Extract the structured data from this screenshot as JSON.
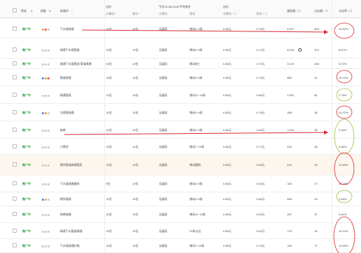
{
  "header": {
    "status": "状态",
    "status_arrow": "∨",
    "quality": "质量",
    "quality_arrow": "∨",
    "keyword": "关键词",
    "keyword_arrow": "↑",
    "bid_group": "出价",
    "bid_pc": "计算机 ↕",
    "bid_mobile": "移动 ↕",
    "rank_group": "今天22:08-23:00平均排名",
    "rank_pc": "计算机",
    "rank_mobile": "移动",
    "cpc_group": "出价",
    "cpc_pc": "计算机 ↕ ▽",
    "cpc_mobile": "移动 ↕ ▽",
    "impressions": "展现量 ↕ ▽",
    "clicks": "点击量 ↓ ▽",
    "ctr": "点击率 ↕ ▽"
  },
  "rows": [
    {
      "status": "推广中",
      "dots": [
        "orange",
        "red",
        "gray"
      ],
      "keyword": "下水道疏通",
      "bid_pc": "10位",
      "bid_mb": "10位",
      "rank_pc": "无展现",
      "rank_mb": "移动4~6条",
      "cpc_pc": "0.85元",
      "cpc_mb": "0.78元",
      "impr": "6,527",
      "clicks": "693",
      "ctr": "10.62%"
    },
    {
      "status": "推广中",
      "dots": [
        "gray",
        "gray",
        "gray"
      ],
      "keyword": "疏通下水道管道",
      "bid_pc": "10位",
      "bid_mb": "10位",
      "rank_pc": "无展现",
      "rank_mb": "移动4~6条",
      "cpc_pc": "0.85元",
      "cpc_mb": "0.74元",
      "impr": "6,618",
      "impr_info": "i",
      "clicks": "574",
      "ctr": "8.67%"
    },
    {
      "status": "推广中",
      "dots": [
        "gray",
        "gray",
        "gray"
      ],
      "keyword": "疏通下水道管道 管道疏通",
      "bid_pc": "10位",
      "bid_mb": "10位",
      "rank_pc": "无展现",
      "rank_mb": "移动前三",
      "cpc_pc": "0.85元",
      "cpc_mb": "0.78元",
      "impr": "3,122",
      "clicks": "236",
      "ctr": "6.72%"
    },
    {
      "status": "推广中",
      "dots": [
        "blue",
        "orange",
        "red"
      ],
      "keyword": "管道疏通",
      "bid_pc": "10位",
      "bid_mb": "10位",
      "rank_pc": "无展现",
      "rank_mb": "移动4~6条",
      "cpc_pc": "0.85元",
      "cpc_mb": "0.78元",
      "impr": "889",
      "clicks": "91",
      "ctr": "10.24%"
    },
    {
      "status": "推广中",
      "dots": [
        "gray",
        "gray",
        "gray"
      ],
      "keyword": "疏通管道",
      "bid_pc": "10位",
      "bid_mb": "10位",
      "rank_pc": "无展现",
      "rank_mb": "移动11~15条",
      "cpc_pc": "0.85元",
      "cpc_mb": "0.66元",
      "impr": "2,051",
      "clicks": "84",
      "ctr": "2.75%"
    },
    {
      "status": "推广中",
      "dots": [
        "blue",
        "orange",
        "gray"
      ],
      "keyword": "大便管疏通",
      "bid_pc": "10位",
      "bid_mb": "10位",
      "rank_pc": "无展现",
      "rank_mb": "移动4~6条",
      "cpc_pc": "0.85元",
      "cpc_mb": "0.78元",
      "impr": "388",
      "clicks": "38",
      "ctr": "10.22%"
    },
    {
      "status": "推广中",
      "dots": [
        "gray",
        "gray",
        "gray"
      ],
      "keyword": "抽粪",
      "bid_pc": "10位",
      "bid_mb": "10位",
      "rank_pc": "无展现",
      "rank_mb": "移动4~6条",
      "cpc_pc": "0.85元",
      "cpc_mb": "0.68元",
      "impr": "1,204",
      "clicks": "38",
      "ctr": "3.16%"
    },
    {
      "status": "推广中",
      "dots": [
        "gray",
        "gray",
        "gray"
      ],
      "keyword": "小便池",
      "bid_pc": "10位",
      "bid_mb": "10位",
      "rank_pc": "无展现",
      "rank_mb": "移动7~10条",
      "cpc_pc": "0.85元",
      "cpc_mb": "0.72元",
      "impr": "532",
      "clicks": "35",
      "ctr": "6.58%"
    },
    {
      "status": "推广中",
      "dots": [
        "gray",
        "gray",
        "gray"
      ],
      "keyword": "厕所管道疏通管家",
      "bid_pc": "10位",
      "bid_mb": "10位",
      "rank_pc": "无展现",
      "rank_mb": "移动靠前",
      "cpc_pc": "0.85元",
      "cpc_mb": "0.65元",
      "impr": "249",
      "clicks": "29",
      "ctr": "11.65%",
      "highlight": true
    },
    {
      "status": "推广中",
      "dots": [
        "gray",
        "gray",
        "gray"
      ],
      "keyword": "下水道疏通维修",
      "bid_pc": "9位",
      "bid_mb": "10位",
      "rank_pc": "无展现",
      "rank_mb": "移动4~6条",
      "cpc_pc": "0.85元",
      "cpc_mb": "0.60元",
      "impr": "160",
      "clicks": "27",
      "ctr": "16.19%"
    },
    {
      "status": "推广中",
      "dots": [
        "blue",
        "orange",
        "gray"
      ],
      "keyword": "厕所疏通",
      "bid_pc": "10位",
      "bid_mb": "10位",
      "rank_pc": "无展现",
      "rank_mb": "移动4~6条",
      "cpc_pc": "0.85元",
      "cpc_mb": "0.66元",
      "impr": "538",
      "clicks": "23",
      "ctr": "4.46%"
    },
    {
      "status": "推广中",
      "dots": [
        "gray",
        "gray",
        "gray"
      ],
      "keyword": "排粪疏通",
      "bid_pc": "10位",
      "bid_mb": "10位",
      "rank_pc": "无展现",
      "rank_mb": "移动11~15条",
      "cpc_pc": "0.85元",
      "cpc_mb": "0.60元",
      "impr": "287",
      "clicks": "22",
      "ctr": "9.61%"
    },
    {
      "status": "推广中",
      "dots": [
        "gray",
        "gray",
        "gray"
      ],
      "keyword": "疏通下水管道疏通",
      "bid_pc": "10位",
      "bid_mb": "10位",
      "rank_pc": "无展现",
      "rank_mb": "20条以后",
      "cpc_pc": "0.85元",
      "cpc_mb": "0.62元",
      "impr": "178",
      "clicks": "18",
      "ctr": "10.11%"
    },
    {
      "status": "推广中",
      "dots": [
        "gray",
        "gray",
        "gray"
      ],
      "keyword": "下水道疏通价格",
      "bid_pc": "10位",
      "bid_mb": "10位",
      "rank_pc": "无展现",
      "rank_mb": "移动7~10条",
      "cpc_pc": "0.85元",
      "cpc_mb": "0.78元",
      "impr": "136",
      "clicks": "17",
      "ctr": "12.50%"
    }
  ],
  "annotations": {
    "circle_color": "#d9292f",
    "green_color": "#9dbf3b",
    "arrow_color": "#d9292f"
  }
}
